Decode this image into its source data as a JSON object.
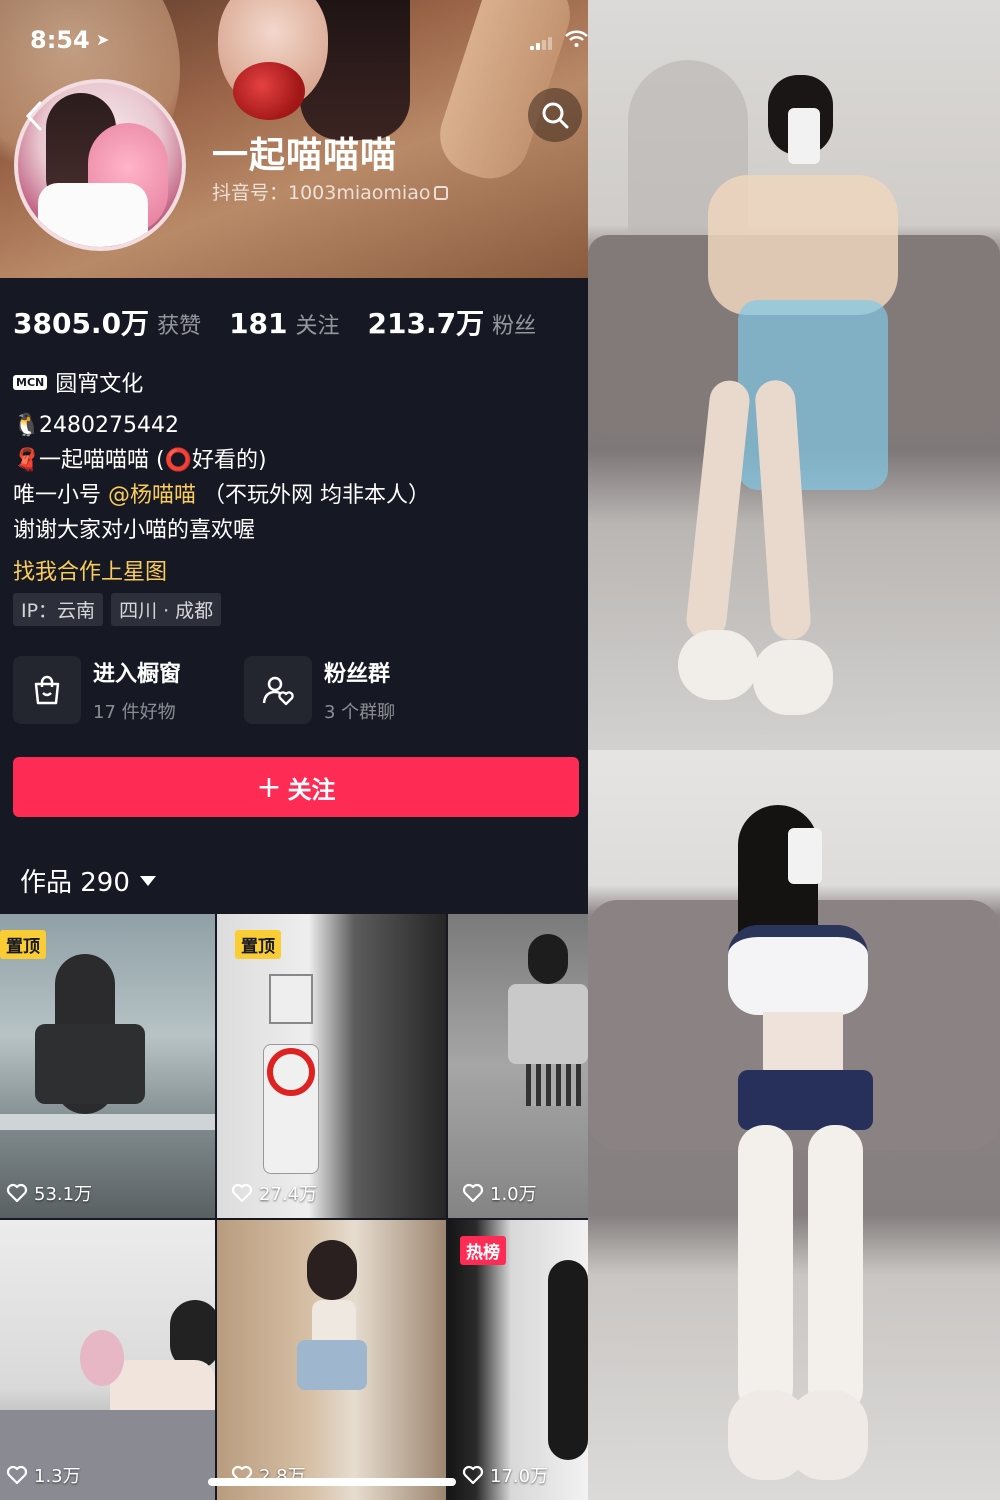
{
  "status_bar": {
    "time": "8:54",
    "location_glyph": "➤"
  },
  "profile": {
    "nickname": "一起喵喵喵",
    "douyin_id": "抖音号：1003miaomiao",
    "stats": [
      {
        "value": "3805.0万",
        "label": "获赞"
      },
      {
        "value": "181",
        "label": "关注"
      },
      {
        "value": "213.7万",
        "label": "粉丝"
      }
    ],
    "mcn_badge": "MCN",
    "mcn_name": "圆宵文化",
    "bio": {
      "qq": "2480275442",
      "line2": "一起喵喵喵 (⭕好看的)",
      "line3_prefix": "唯一小号 ",
      "line3_mention": "@杨喵喵",
      "line3_suffix": " （不玩外网 均非本人）",
      "line4": "谢谢大家对小喵的喜欢喔"
    },
    "star_link": "找我合作上星图",
    "tags": [
      "IP：云南",
      "四川 · 成都"
    ],
    "shop": {
      "title": "进入橱窗",
      "sub": "17 件好物"
    },
    "fans_group": {
      "title": "粉丝群",
      "sub": "3 个群聊"
    },
    "follow_label": "关注",
    "works_label": "作品 290"
  },
  "works": [
    {
      "badge": "置顶",
      "likes": "53.1万"
    },
    {
      "badge": "置顶",
      "likes": "27.4万"
    },
    {
      "badge": "",
      "likes": "1.0万"
    },
    {
      "badge": "",
      "likes": "1.3万"
    },
    {
      "badge": "",
      "likes": "2.8万"
    },
    {
      "badge": "热榜",
      "likes": "17.0万"
    }
  ],
  "icons": [
    "location-arrow-icon",
    "signal-icon",
    "wifi-icon",
    "back-icon",
    "search-icon",
    "copy-icon",
    "shopping-bag-icon",
    "fans-group-icon",
    "plus-icon",
    "caret-down-icon",
    "heart-icon"
  ],
  "colors": {
    "background": "#161823",
    "accent": "#fe2c55",
    "highlight": "#facd5a"
  }
}
